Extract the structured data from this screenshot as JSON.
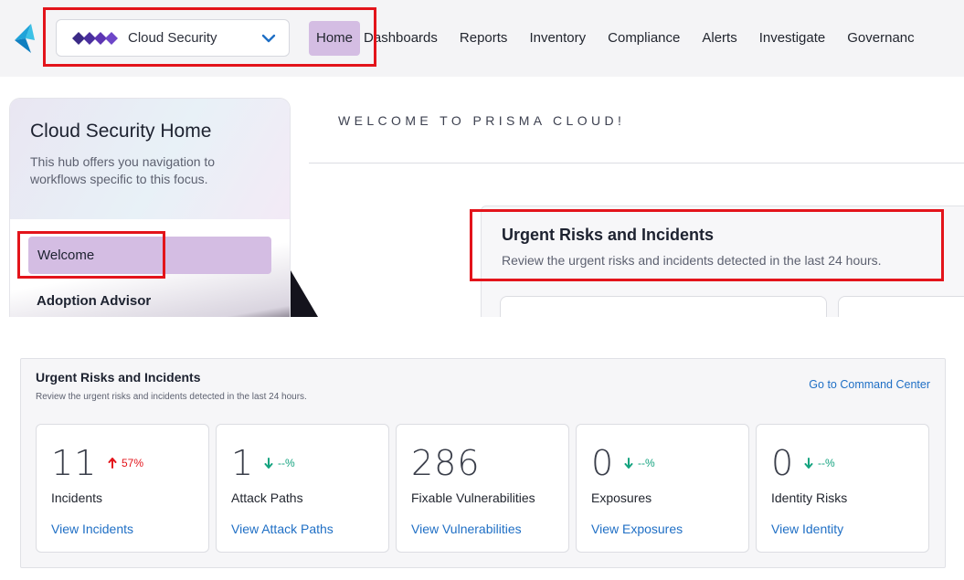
{
  "topbar": {
    "switcher_label": "Cloud Security",
    "nav": [
      {
        "label": "Home",
        "active": true
      },
      {
        "label": "Dashboards"
      },
      {
        "label": "Reports"
      },
      {
        "label": "Inventory"
      },
      {
        "label": "Compliance"
      },
      {
        "label": "Alerts"
      },
      {
        "label": "Investigate"
      },
      {
        "label": "Governanc"
      }
    ]
  },
  "hub": {
    "title": "Cloud Security Home",
    "description": "This hub offers you navigation to workflows specific to this focus.",
    "items": [
      {
        "label": "Welcome",
        "active": true
      },
      {
        "label": "Adoption Advisor"
      }
    ]
  },
  "main": {
    "welcome_heading": "WELCOME TO PRISMA CLOUD!",
    "urgent_top": {
      "title": "Urgent Risks and Incidents",
      "subtitle": "Review the urgent risks and incidents detected in the last 24 hours."
    }
  },
  "panel": {
    "title": "Urgent Risks and Incidents",
    "subtitle": "Review the urgent risks and incidents detected in the last 24 hours.",
    "link": "Go to Command Center",
    "cards": [
      {
        "value": "11",
        "trend": "57%",
        "direction": "up",
        "label": "Incidents",
        "link": "View Incidents"
      },
      {
        "value": "1",
        "trend": "--%",
        "direction": "down",
        "label": "Attack Paths",
        "link": "View Attack Paths"
      },
      {
        "value": "286",
        "trend": "",
        "direction": "none",
        "label": "Fixable Vulnerabilities",
        "link": "View Vulnerabilities"
      },
      {
        "value": "0",
        "trend": "--%",
        "direction": "down",
        "label": "Exposures",
        "link": "View Exposures"
      },
      {
        "value": "0",
        "trend": "--%",
        "direction": "down",
        "label": "Identity Risks",
        "link": "View Identity"
      }
    ]
  },
  "colors": {
    "accent_purple": "#d4bde3",
    "highlight_red": "#e3141b",
    "link_blue": "#1f6fc5",
    "trend_up_red": "#e3141b",
    "trend_down_green": "#14a37f"
  }
}
